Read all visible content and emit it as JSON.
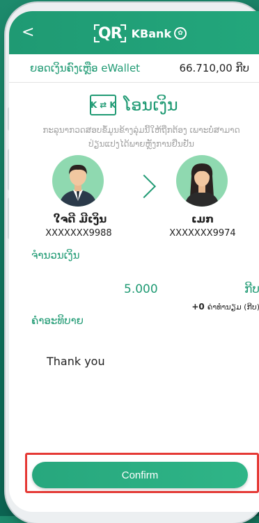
{
  "header": {
    "back_glyph": "<",
    "logo_qr": "QR",
    "logo_bank": "KBank"
  },
  "balance": {
    "label": "ຍອດເງິນຄົງເຫຼືອ eWallet",
    "value": "66.710,00 ກີບ"
  },
  "transfer": {
    "title": "ໂອນເງິນ",
    "hint_line1": "ກະລຸນາກວດສອບຂໍ້ມູນຂ້າງລຸ່ມນີ້ໃຫ້ຖືກຕ້ອງ ເພາະບໍ່ສາມາດ",
    "hint_line2": "ປ່ຽນແປງໄດ້ພາຍຫຼັງການຢືນຢັນ"
  },
  "sender": {
    "name": "ໃຈດີ ມີເງິນ",
    "account": "XXXXXXX9988"
  },
  "receiver": {
    "name": "ເມກ",
    "account": "XXXXXXX9974"
  },
  "amount": {
    "label": "ຈຳນວນເງິນ",
    "value": "5.000",
    "currency": "ກີບ",
    "fee_value": "+0",
    "fee_label": "ຄ່າທຳນຽມ (ກີບ)"
  },
  "description": {
    "label": "ຄຳອະທິບາຍ",
    "text": "Thank you"
  },
  "actions": {
    "confirm_label": "Confirm"
  },
  "colors": {
    "brand_green": "#1f9a73",
    "highlight_red": "#e53935"
  }
}
